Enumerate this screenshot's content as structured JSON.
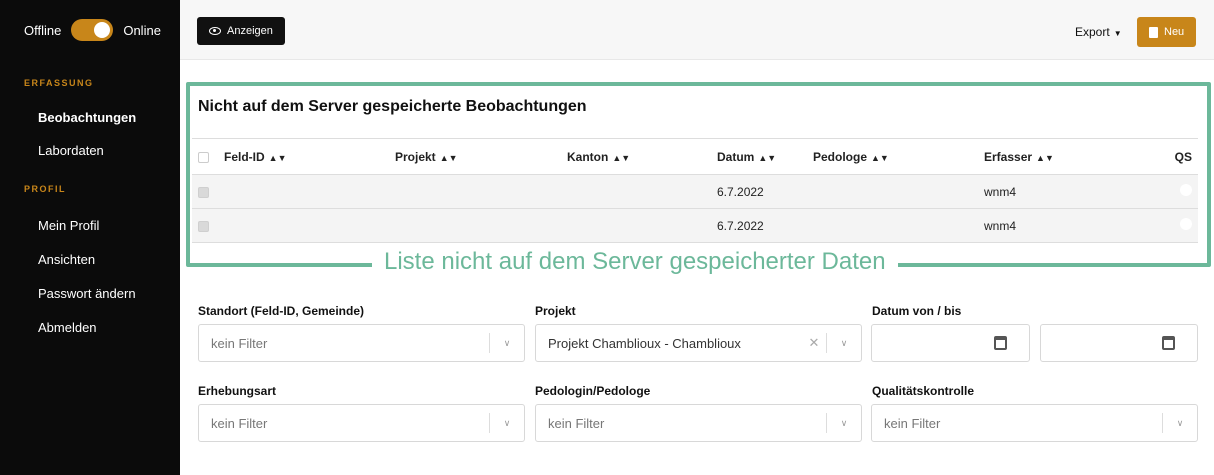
{
  "sidebar": {
    "offline_label": "Offline",
    "online_label": "Online",
    "section_capture": "ERFASSUNG",
    "items_capture": [
      "Beobachtungen",
      "Labordaten"
    ],
    "section_profile": "PROFIL",
    "items_profile": [
      "Mein Profil",
      "Ansichten",
      "Passwort ändern",
      "Abmelden"
    ]
  },
  "toolbar": {
    "show_label": "Anzeigen",
    "export_label": "Export",
    "new_label": "Neu"
  },
  "unsaved": {
    "title": "Nicht auf dem Server gespeicherte Beobachtungen",
    "columns": [
      "Feld-ID",
      "Projekt",
      "Kanton",
      "Datum",
      "Pedologe",
      "Erfasser",
      "QS"
    ],
    "rows": [
      {
        "feld_id": "",
        "projekt": "",
        "kanton": "",
        "datum": "6.7.2022",
        "pedologe": "",
        "erfasser": "wnm4"
      },
      {
        "feld_id": "",
        "projekt": "",
        "kanton": "",
        "datum": "6.7.2022",
        "pedologe": "",
        "erfasser": "wnm4"
      }
    ],
    "annotation": "Liste nicht auf dem Server gespeicherter Daten"
  },
  "filters": {
    "standort": {
      "label": "Standort (Feld-ID, Gemeinde)",
      "placeholder": "kein Filter"
    },
    "projekt": {
      "label": "Projekt",
      "value": "Projekt Chamblioux - Chamblioux"
    },
    "datum": {
      "label": "Datum von / bis"
    },
    "erhebungsart": {
      "label": "Erhebungsart",
      "placeholder": "kein Filter"
    },
    "pedologe": {
      "label": "Pedologin/Pedologe",
      "placeholder": "kein Filter"
    },
    "qualitaet": {
      "label": "Qualitätskontrolle",
      "placeholder": "kein Filter"
    }
  },
  "colors": {
    "accent": "#c8861a",
    "highlight": "#6cb89a",
    "sidebar": "#0b0b0b"
  }
}
